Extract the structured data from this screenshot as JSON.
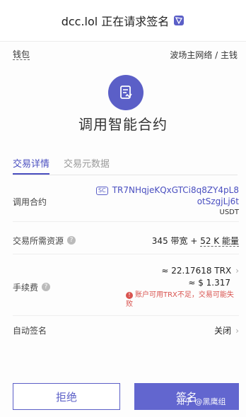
{
  "header": {
    "title": "dcc.lol 正在请求签名",
    "logo_icon": "tronlink-logo-icon"
  },
  "topbar": {
    "wallet": "钱包",
    "network": "波场主网络 / 主钱"
  },
  "action": {
    "icon": "contract-document-icon",
    "title": "调用智能合约"
  },
  "tabs": [
    {
      "label": "交易详情",
      "active": true
    },
    {
      "label": "交易元数据",
      "active": false
    }
  ],
  "rows": {
    "contract": {
      "label": "调用合约",
      "badge": "SC",
      "address_line1": "TR7NHqjeKQxGTCi8q8ZY4pL8",
      "address_line2": "otSzgjLj6t",
      "token": "USDT"
    },
    "resources": {
      "label": "交易所需资源",
      "value_prefix": "345 带宽 +",
      "value_energy": "52 K 能量"
    },
    "fee": {
      "label": "手续费",
      "trx": "≈ 22.17618 TRX",
      "usd": "≈ $ 1.317",
      "warning": "账户可用TRX不足，交易可能失败"
    },
    "auto_sign": {
      "label": "自动签名",
      "value": "关闭"
    }
  },
  "buttons": {
    "reject": "拒绝",
    "sign": "签名"
  },
  "watermark": "知乎 @黑鹰组",
  "colors": {
    "accent": "#5b5fc7",
    "warning": "#d9534f"
  }
}
